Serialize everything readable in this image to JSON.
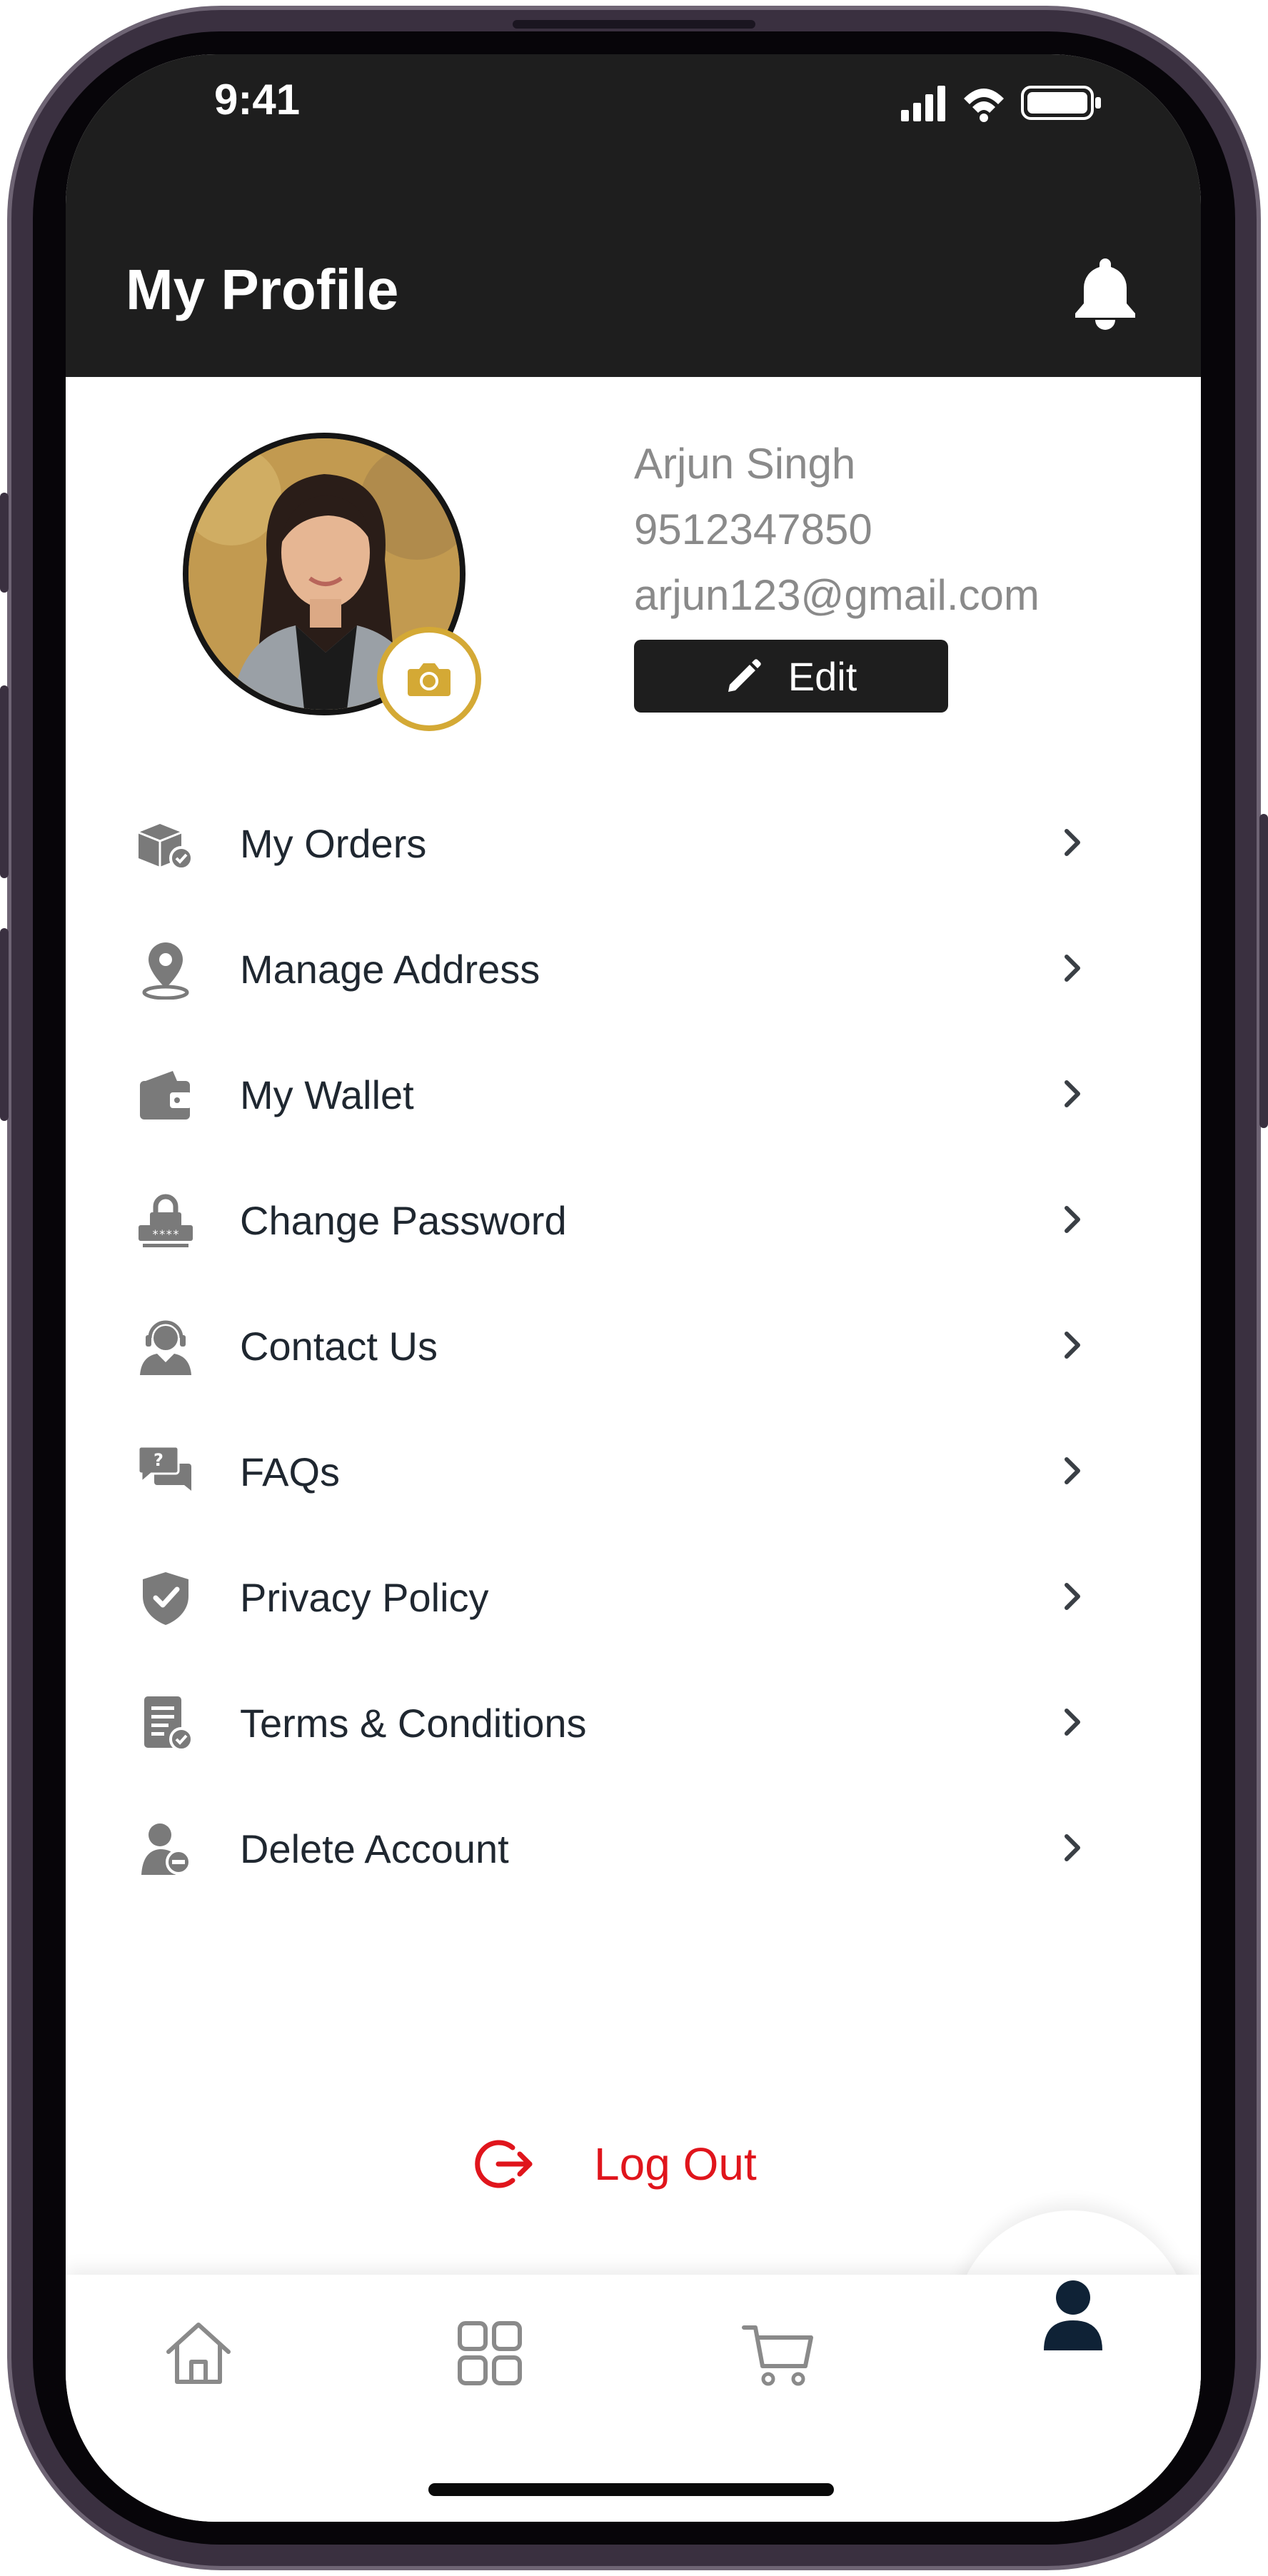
{
  "status_bar": {
    "time": "9:41"
  },
  "header": {
    "title": "My Profile"
  },
  "profile": {
    "name": "Arjun Singh",
    "phone": "9512347850",
    "email": "arjun123@gmail.com",
    "edit_label": "Edit"
  },
  "menu": {
    "items": [
      {
        "label": "My Orders",
        "icon": "orders-box-icon"
      },
      {
        "label": "Manage Address",
        "icon": "location-pin-icon"
      },
      {
        "label": "My Wallet",
        "icon": "wallet-icon"
      },
      {
        "label": "Change Password",
        "icon": "lock-password-icon"
      },
      {
        "label": "Contact Us",
        "icon": "support-agent-icon"
      },
      {
        "label": "FAQs",
        "icon": "faq-chat-icon"
      },
      {
        "label": "Privacy Policy",
        "icon": "shield-check-icon"
      },
      {
        "label": "Terms & Conditions",
        "icon": "document-check-icon"
      },
      {
        "label": "Delete Account",
        "icon": "user-remove-icon"
      }
    ]
  },
  "logout": {
    "label": "Log Out"
  },
  "bottom_nav": {
    "items": [
      "home-icon",
      "categories-grid-icon",
      "cart-icon",
      "profile-icon"
    ],
    "active": "profile-icon"
  },
  "colors": {
    "header_bg": "#1e1e1e",
    "accent_gold": "#d4a935",
    "logout_red": "#e0151c",
    "icon_gray": "#7a7a7a"
  }
}
